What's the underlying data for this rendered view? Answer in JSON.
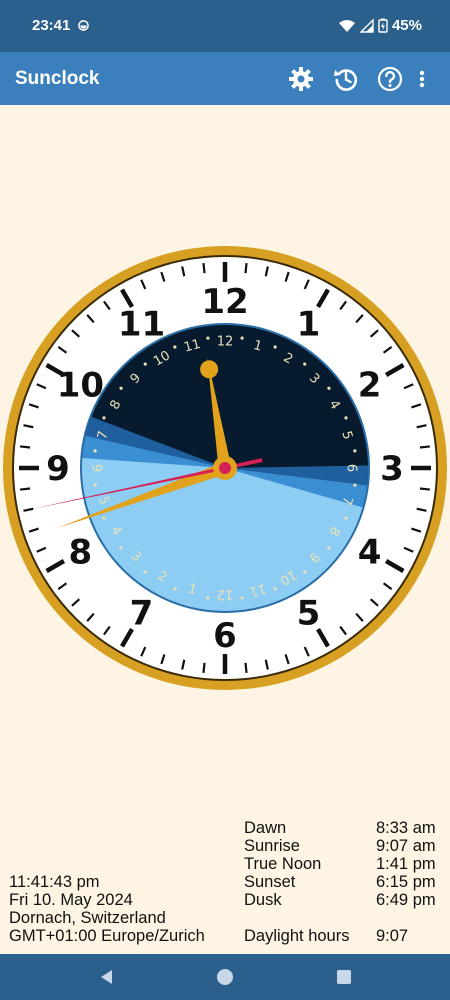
{
  "status_bar": {
    "time": "23:41",
    "battery": "45%"
  },
  "app_bar": {
    "title": "Sunclock"
  },
  "clock": {
    "hour_numerals": [
      "12",
      "1",
      "2",
      "3",
      "4",
      "5",
      "6",
      "7",
      "8",
      "9",
      "10",
      "11"
    ],
    "dial_numbers_inner": [
      "1",
      "2",
      "3",
      "4",
      "5",
      "6",
      "7",
      "8",
      "9",
      "10",
      "11",
      "12",
      "1",
      "2",
      "3",
      "4",
      "5",
      "6",
      "7",
      "8",
      "9",
      "10",
      "11",
      "12"
    ],
    "time": {
      "hours": 11,
      "minutes": 41,
      "seconds": 43
    },
    "colors": {
      "rim": "#d7a022",
      "face": "#ffffff",
      "night": "#071a2e",
      "day": "#8ecdf3",
      "twilight": "#3a8fd2",
      "hands": "#e2a21c",
      "second_hand": "#d4215a",
      "numerals": "#111111",
      "inner_numbers": "#e8e1b8"
    }
  },
  "info": {
    "current_time": "11:41:43 pm",
    "date": "Fri 10. May 2024",
    "location": "Dornach, Switzerland",
    "timezone": "GMT+01:00 Europe/Zurich",
    "sun_events": [
      {
        "label": "Dawn",
        "value": "8:33 am"
      },
      {
        "label": "Sunrise",
        "value": "9:07 am"
      },
      {
        "label": "True Noon",
        "value": "1:41 pm"
      },
      {
        "label": "Sunset",
        "value": "6:15 pm"
      },
      {
        "label": "Dusk",
        "value": "6:49 pm"
      }
    ],
    "daylight": {
      "label": "Daylight hours",
      "value": "9:07"
    }
  }
}
